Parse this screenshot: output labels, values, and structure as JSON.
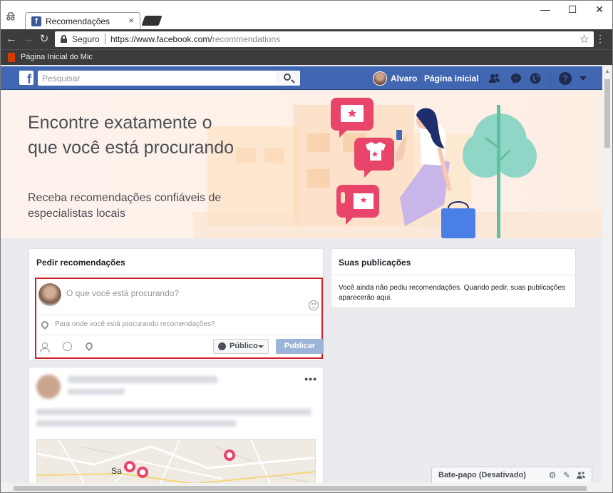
{
  "browser": {
    "tab_title": "Recomendações",
    "tab_close": "×",
    "secure_label": "Seguro",
    "url_host": "https://www.facebook.com/",
    "url_path": "recommendations",
    "bookmark_label": "Página Inicial do Mic",
    "window_controls": {
      "minimize": "—",
      "maximize": "☐",
      "close": "✕"
    },
    "nav": {
      "back": "←",
      "forward": "→",
      "reload": "↻",
      "star": "☆",
      "menu": "⋮"
    }
  },
  "facebook_header": {
    "search_placeholder": "Pesquisar",
    "user_name": "Alvaro",
    "home_label": "Página inicial",
    "icons": [
      "friend-requests-icon",
      "messenger-icon",
      "notifications-globe-icon",
      "help-icon",
      "account-menu-caret-icon"
    ],
    "help_glyph": "?",
    "brand_color": "#4267b2"
  },
  "hero": {
    "title": "Encontre exatamente o que você está procurando",
    "subtitle": "Receba recomendações confiáveis de especialistas locais"
  },
  "ask_card": {
    "heading": "Pedir recomendações",
    "input_placeholder": "O que você está procurando?",
    "location_placeholder": "Para onde você está procurando recomendações?",
    "audience_label": "Público",
    "publish_label": "Publicar",
    "highlight_color": "#d21f27"
  },
  "posts_card": {
    "heading": "Suas publicações",
    "empty_text": "Você ainda não pediu recomendações. Quando pedir, suas publicações aparecerão aqui."
  },
  "blurred_post": {
    "options_glyph": "•••",
    "map_label": "Sa"
  },
  "chat": {
    "label": "Bate-papo (Desativado)"
  }
}
